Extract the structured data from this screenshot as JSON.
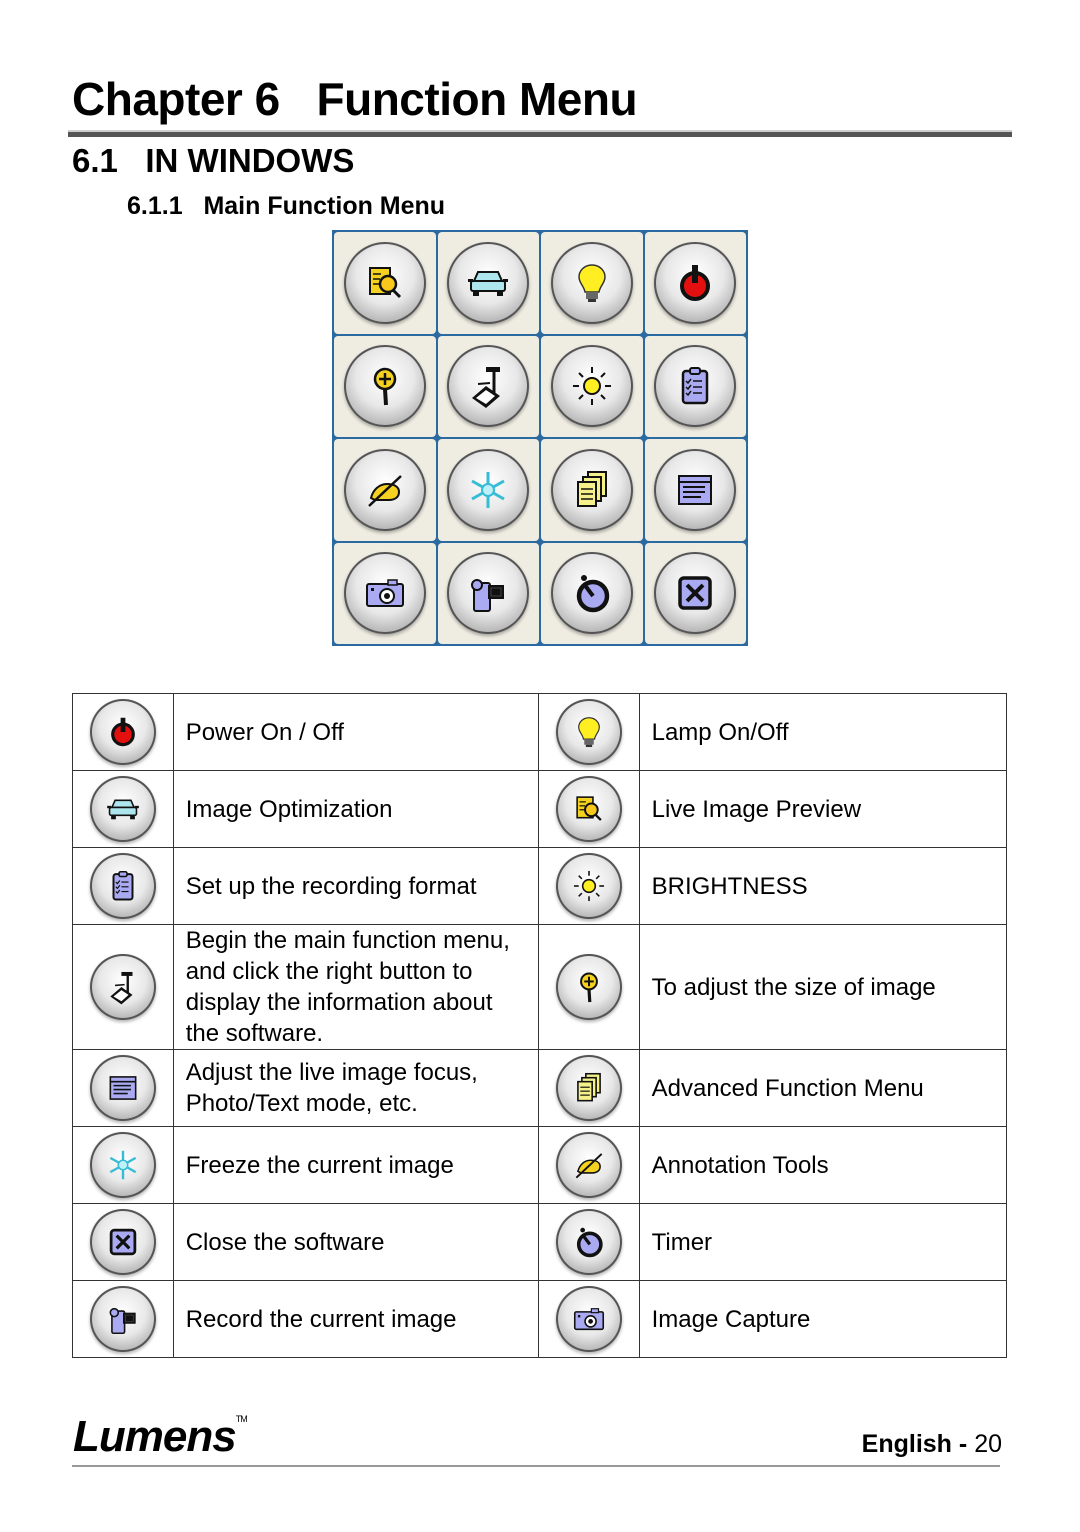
{
  "heading": {
    "chapter": "Chapter 6   Function Menu",
    "section": "6.1   IN WINDOWS",
    "subsection": "6.1.1   Main Function Menu"
  },
  "menu_grid": {
    "buttons": [
      {
        "icon": "live-preview-icon",
        "label": "Live Image Preview"
      },
      {
        "icon": "car-icon",
        "label": "Image Optimization"
      },
      {
        "icon": "lightbulb-icon",
        "label": "Lamp On/Off"
      },
      {
        "icon": "power-icon",
        "label": "Power On / Off"
      },
      {
        "icon": "zoom-in-icon",
        "label": "Zoom"
      },
      {
        "icon": "document-camera-icon",
        "label": "Main Function Menu"
      },
      {
        "icon": "sun-icon",
        "label": "Brightness"
      },
      {
        "icon": "clipboard-icon",
        "label": "Recording Format"
      },
      {
        "icon": "annotation-hand-icon",
        "label": "Annotation Tools"
      },
      {
        "icon": "snowflake-icon",
        "label": "Freeze"
      },
      {
        "icon": "stacked-pages-icon",
        "label": "Advanced Function Menu"
      },
      {
        "icon": "settings-window-icon",
        "label": "Image Settings"
      },
      {
        "icon": "camera-icon",
        "label": "Image Capture"
      },
      {
        "icon": "camcorder-icon",
        "label": "Record"
      },
      {
        "icon": "timer-icon",
        "label": "Timer"
      },
      {
        "icon": "close-box-icon",
        "label": "Close"
      }
    ]
  },
  "legend": {
    "rows": [
      {
        "left": {
          "icon": "power-icon",
          "text": "Power On / Off"
        },
        "right": {
          "icon": "lightbulb-icon",
          "text": "Lamp On/Off"
        }
      },
      {
        "left": {
          "icon": "car-icon",
          "text": "Image Optimization"
        },
        "right": {
          "icon": "live-preview-icon",
          "text": "Live Image Preview"
        }
      },
      {
        "left": {
          "icon": "clipboard-icon",
          "text": "Set up the recording format"
        },
        "right": {
          "icon": "sun-icon",
          "text": "BRIGHTNESS"
        }
      },
      {
        "left": {
          "icon": "document-camera-icon",
          "text": "Begin the main function menu, and click the right button to display the information about the software."
        },
        "right": {
          "icon": "zoom-in-icon",
          "text": "To adjust the size of image"
        }
      },
      {
        "left": {
          "icon": "settings-window-icon",
          "text": "Adjust the live image focus, Photo/Text mode, etc."
        },
        "right": {
          "icon": "stacked-pages-icon",
          "text": "Advanced Function Menu"
        }
      },
      {
        "left": {
          "icon": "snowflake-icon",
          "text": "Freeze the current image"
        },
        "right": {
          "icon": "annotation-hand-icon",
          "text": "Annotation Tools"
        }
      },
      {
        "left": {
          "icon": "close-box-icon",
          "text": "Close the software"
        },
        "right": {
          "icon": "timer-icon",
          "text": "Timer"
        }
      },
      {
        "left": {
          "icon": "camcorder-icon",
          "text": "Record the current image"
        },
        "right": {
          "icon": "camera-icon",
          "text": "Image Capture"
        }
      }
    ]
  },
  "footer": {
    "brand": "Lumens",
    "trademark": "TM",
    "language": "English",
    "separator": " - ",
    "page_number": "20"
  }
}
